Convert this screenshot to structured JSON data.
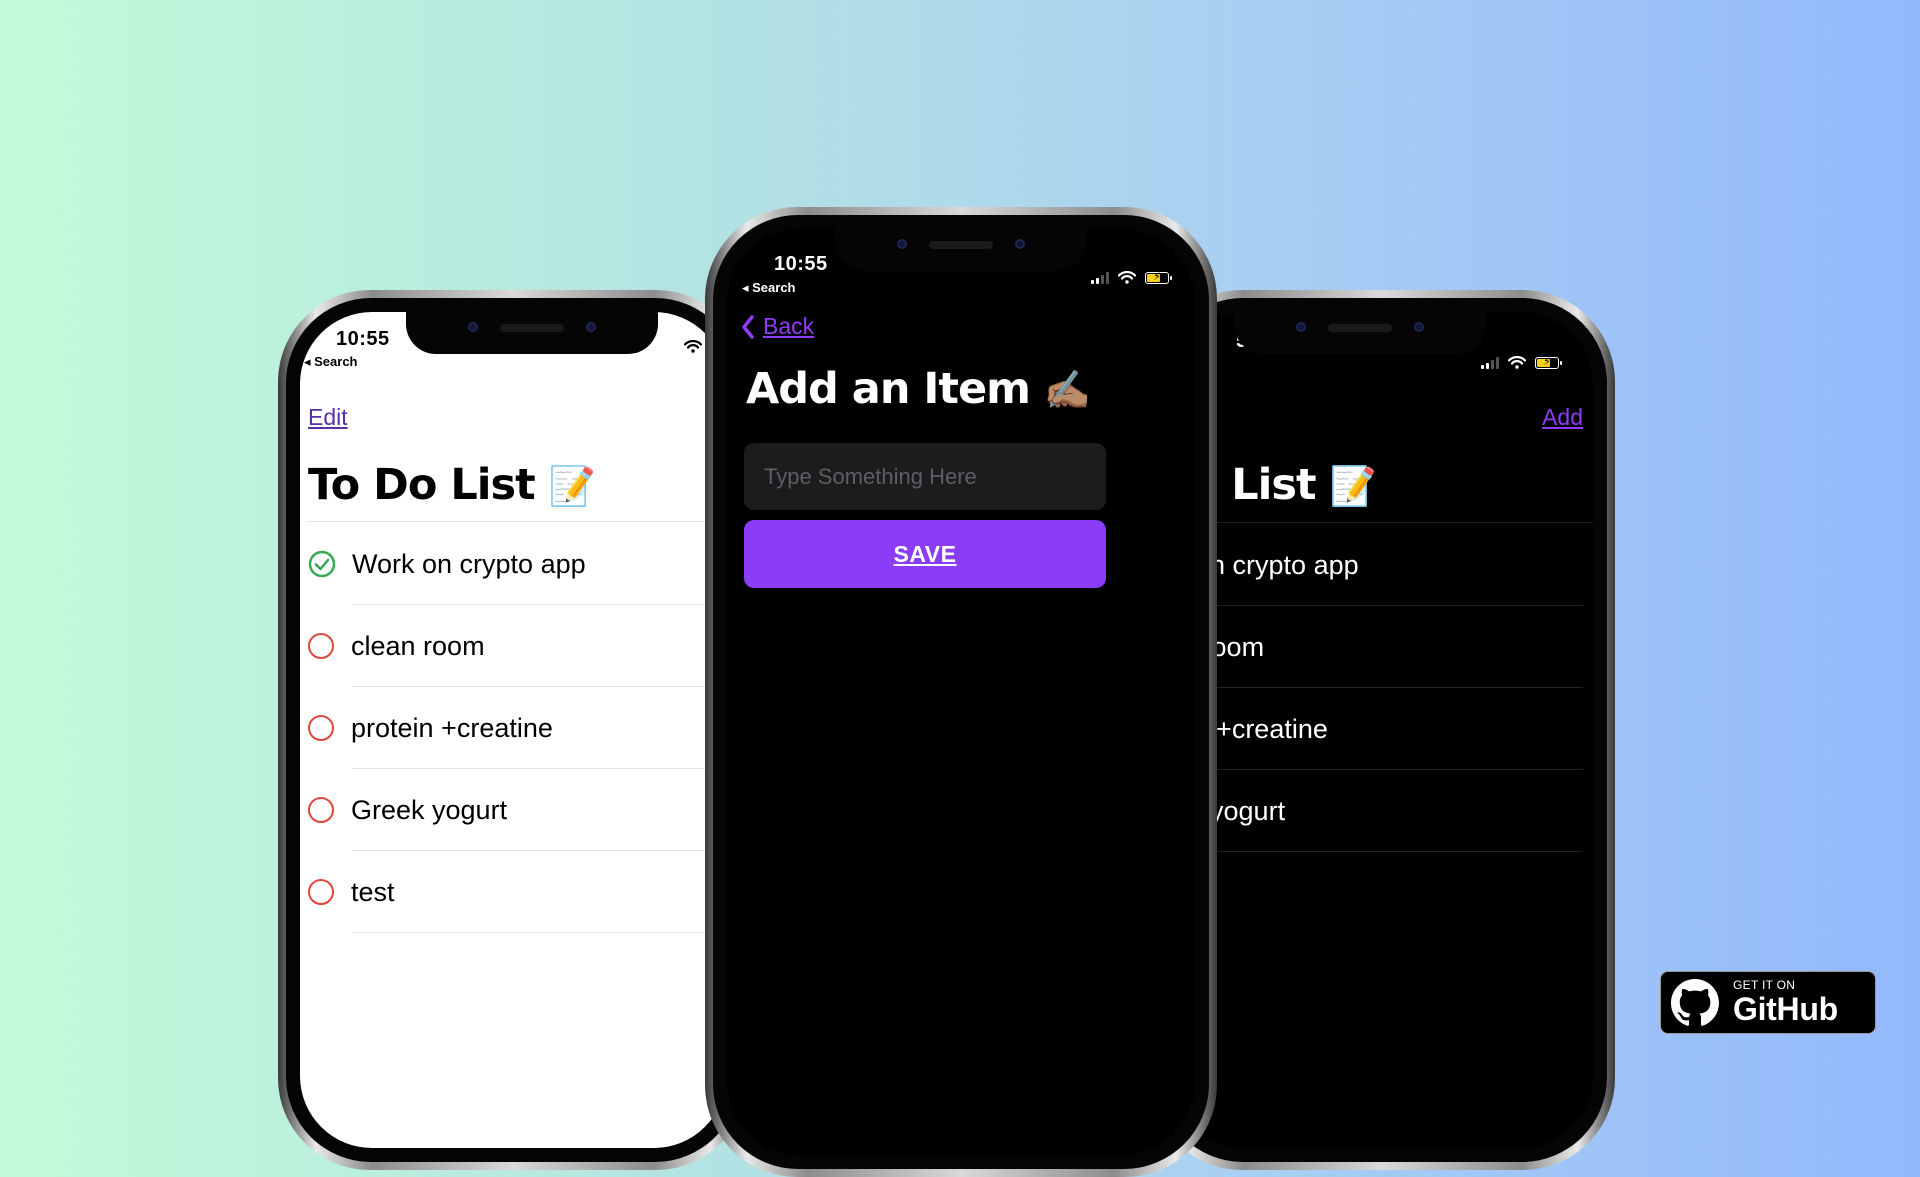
{
  "status_bar": {
    "time": "10:55",
    "back_app": "Search"
  },
  "left_phone": {
    "edit_label": "Edit",
    "title": "To Do List",
    "title_emoji": "📝",
    "items": [
      {
        "label": "Work on crypto app",
        "status": "done"
      },
      {
        "label": "clean room",
        "status": "todo"
      },
      {
        "label": "protein +creatine",
        "status": "todo"
      },
      {
        "label": "Greek yogurt",
        "status": "todo"
      },
      {
        "label": "test",
        "status": "todo"
      }
    ]
  },
  "center_phone": {
    "back_label": "Back",
    "title": "Add an Item",
    "title_emoji": "✍🏽",
    "input_placeholder": "Type Something Here",
    "save_label": "SAVE"
  },
  "right_phone": {
    "time_partial": "5",
    "add_label": "Add",
    "title_partial": "Do List",
    "title_emoji": "📝",
    "items": [
      {
        "label": "ork on crypto app"
      },
      {
        "label": "ean room"
      },
      {
        "label": "otein +creatine"
      },
      {
        "label": "reek yogurt"
      }
    ]
  },
  "github_badge": {
    "top_text": "GET IT ON",
    "brand_text": "GitHub"
  },
  "colors": {
    "accent_purple": "#8a3cf7",
    "link_purple_light": "#5a2fa8",
    "check_green": "#34a853",
    "todo_red": "#e0473c",
    "background_left": "#c2fbd8",
    "background_right": "#93b8fc"
  }
}
